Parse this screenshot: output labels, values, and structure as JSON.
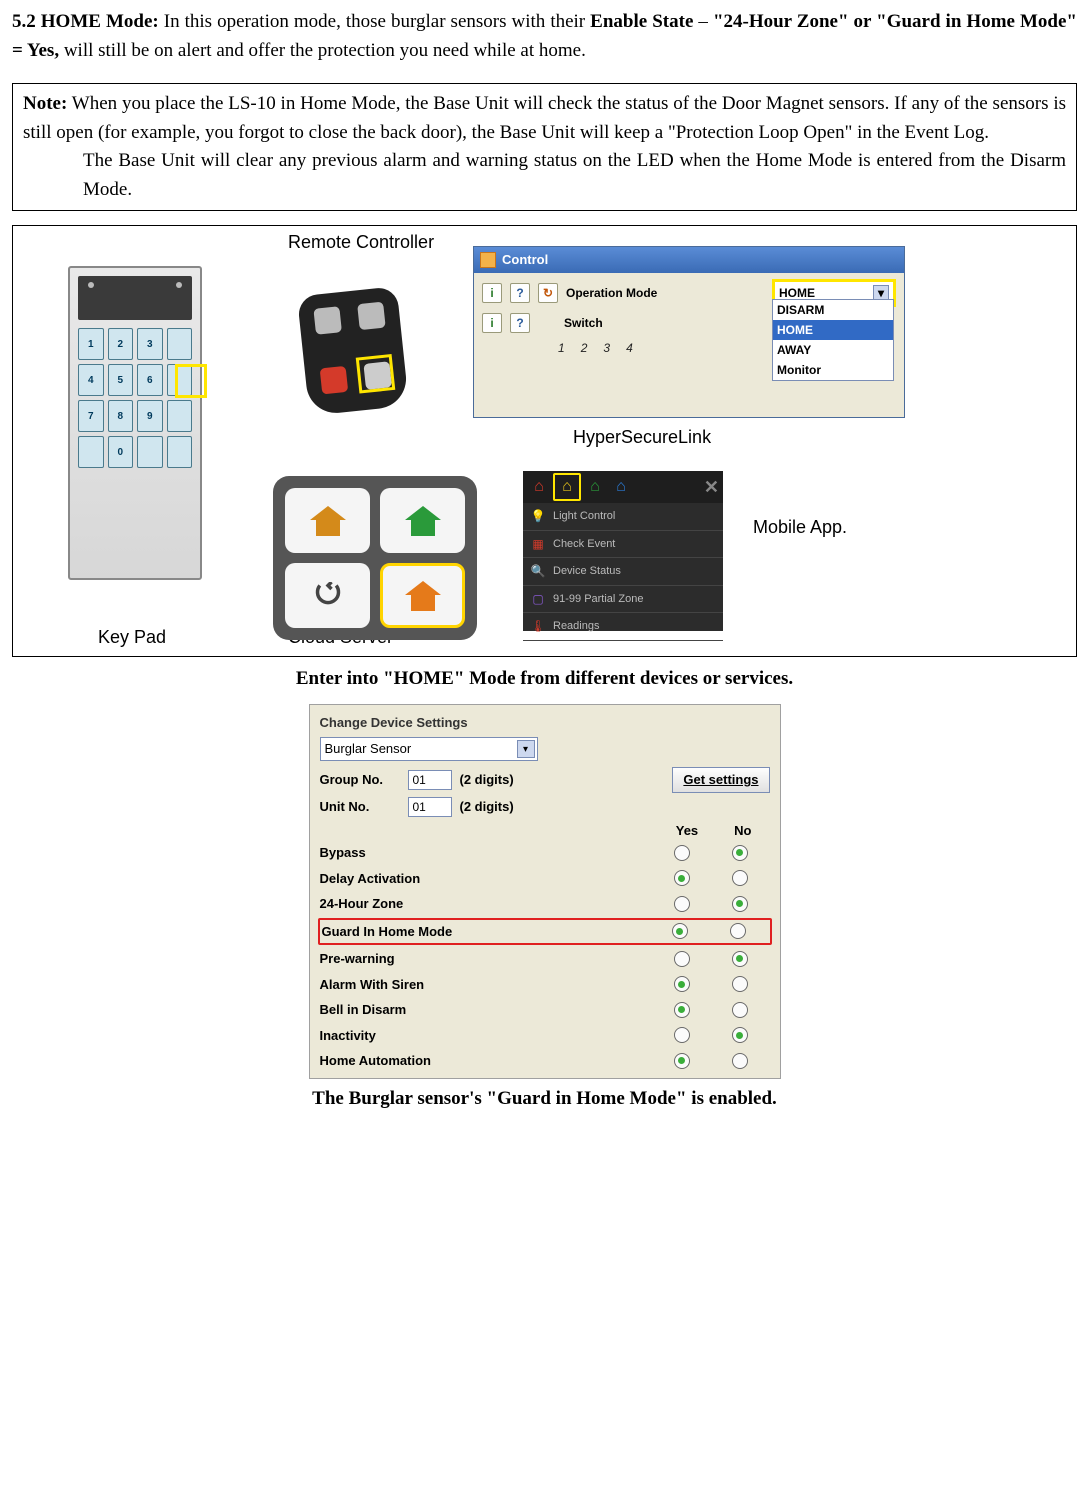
{
  "section": {
    "heading_prefix": "5.2 HOME Mode: ",
    "intro_1": "In this operation mode, those burglar sensors with their ",
    "bold_enable": "Enable State",
    "dash": " – ",
    "bold_zone": "\"24-Hour Zone\" or \"Guard in Home Mode\" = Yes,",
    "intro_2": " will still be on alert and offer the protection you need while at home."
  },
  "note": {
    "label": "Note:",
    "p1": "When you place the LS-10 in Home Mode, the Base Unit will check the status of the Door Magnet sensors. If any of the sensors is still open (for example, you forgot to close the back door), the Base Unit will keep a \"Protection Loop Open\" in the Event Log.",
    "p2": "The Base Unit will clear any previous alarm and warning status on the LED when the Home Mode is entered from the Disarm Mode."
  },
  "figure1": {
    "labels": {
      "remote": "Remote Controller",
      "hsl": "HyperSecureLink",
      "mobile": "Mobile App.",
      "keypad": "Key Pad",
      "cloud": "Cloud Server"
    },
    "keypad_keys": [
      "1",
      "2",
      "3",
      "",
      "4",
      "5",
      "6",
      "",
      "7",
      "8",
      "9",
      "",
      "",
      "0",
      "",
      ""
    ],
    "hsl": {
      "title": "Control",
      "row1": "Operation Mode",
      "row2": "Switch",
      "selected": "HOME",
      "options": [
        "DISARM",
        "HOME",
        "AWAY",
        "Monitor"
      ],
      "switch_nums": [
        "1",
        "2",
        "3",
        "4"
      ]
    },
    "mobile": {
      "items": [
        {
          "icon": "💡",
          "label": "Light Control",
          "color": "#e5c21a"
        },
        {
          "icon": "▦",
          "label": "Check Event",
          "color": "#d43a2a"
        },
        {
          "icon": "🔍",
          "label": "Device Status",
          "color": "#2a9ad4"
        },
        {
          "icon": "▢",
          "label": "91-99 Partial Zone",
          "color": "#8a5ad4"
        },
        {
          "icon": "🌡",
          "label": "Readings",
          "color": "#d43a2a"
        }
      ]
    },
    "caption": "Enter into \"HOME\" Mode from different devices or services."
  },
  "figure2": {
    "title": "Change Device Settings",
    "device_type": "Burglar Sensor",
    "group_label": "Group No.",
    "group_val": "01",
    "unit_label": "Unit No.",
    "unit_val": "01",
    "digits": "(2 digits)",
    "get_btn": "Get settings",
    "yes": "Yes",
    "no": "No",
    "rows": [
      {
        "label": "Bypass",
        "yes": false,
        "no": true,
        "hl": false
      },
      {
        "label": "Delay Activation",
        "yes": true,
        "no": false,
        "hl": false
      },
      {
        "label": "24-Hour Zone",
        "yes": false,
        "no": true,
        "hl": false
      },
      {
        "label": "Guard In Home Mode",
        "yes": true,
        "no": false,
        "hl": true
      },
      {
        "label": "Pre-warning",
        "yes": false,
        "no": true,
        "hl": false
      },
      {
        "label": "Alarm With Siren",
        "yes": true,
        "no": false,
        "hl": false
      },
      {
        "label": "Bell in Disarm",
        "yes": true,
        "no": false,
        "hl": false
      },
      {
        "label": "Inactivity",
        "yes": false,
        "no": true,
        "hl": false
      },
      {
        "label": "Home Automation",
        "yes": true,
        "no": false,
        "hl": false
      }
    ],
    "caption": "The Burglar sensor's \"Guard in Home Mode\" is enabled."
  }
}
